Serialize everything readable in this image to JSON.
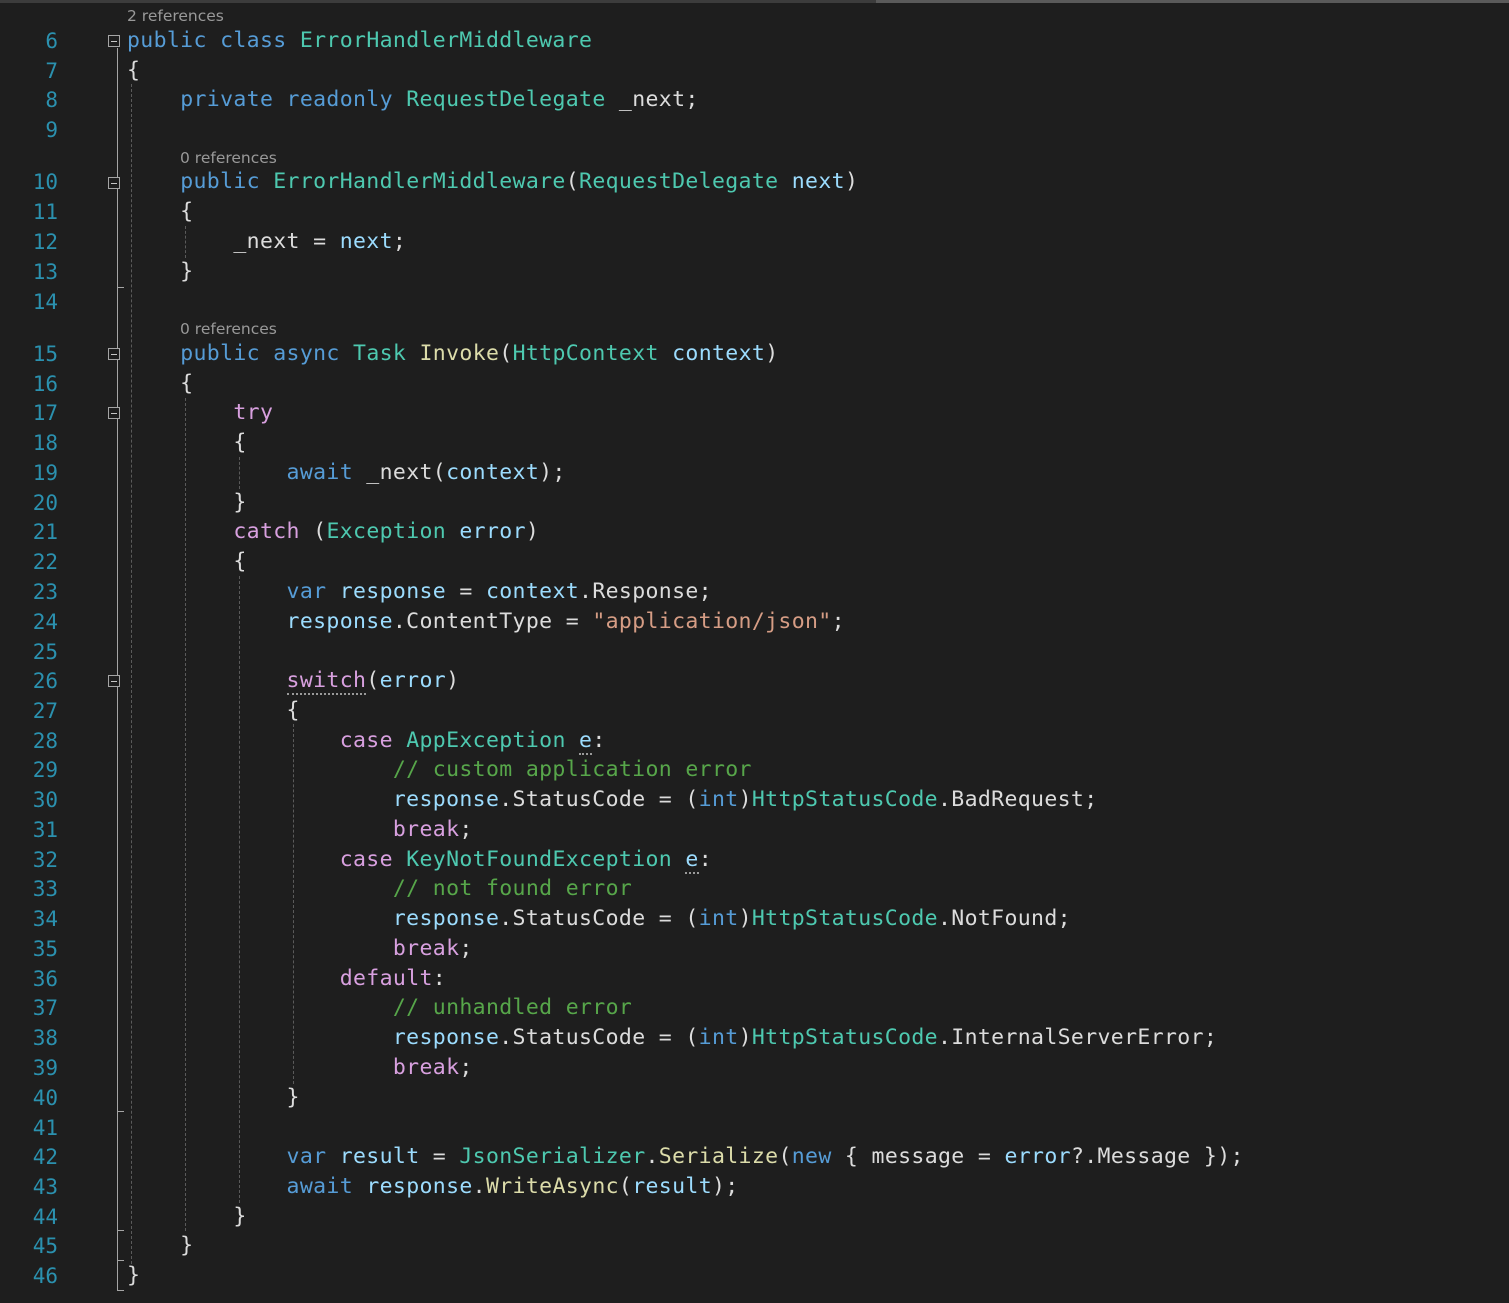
{
  "editor": {
    "language": "C#",
    "theme_colors": {
      "background": "#1e1e1e",
      "line_number": "#2b91af",
      "keyword": "#569cd6",
      "control_keyword": "#d8a0df",
      "type": "#4ec9b0",
      "method": "#dcdcaa",
      "variable": "#9cdcfe",
      "string": "#d69d85",
      "comment": "#57a64a",
      "plain": "#dcdcdc",
      "codelens": "#999999"
    },
    "codelens": {
      "class_refs": "2 references",
      "ctor_refs": "0 references",
      "invoke_refs": "0 references"
    },
    "lines": [
      {
        "num": "6",
        "tokens": [
          [
            "kw",
            "public"
          ],
          [
            "plain",
            " "
          ],
          [
            "kw",
            "class"
          ],
          [
            "plain",
            " "
          ],
          [
            "type",
            "ErrorHandlerMiddleware"
          ]
        ]
      },
      {
        "num": "7",
        "tokens": [
          [
            "plain",
            "{"
          ]
        ]
      },
      {
        "num": "8",
        "tokens": [
          [
            "plain",
            "    "
          ],
          [
            "kw",
            "private"
          ],
          [
            "plain",
            " "
          ],
          [
            "kw",
            "readonly"
          ],
          [
            "plain",
            " "
          ],
          [
            "type",
            "RequestDelegate"
          ],
          [
            "plain",
            " _next;"
          ]
        ]
      },
      {
        "num": "9",
        "tokens": []
      },
      {
        "num": "10",
        "tokens": [
          [
            "plain",
            "    "
          ],
          [
            "kw",
            "public"
          ],
          [
            "plain",
            " "
          ],
          [
            "type",
            "ErrorHandlerMiddleware"
          ],
          [
            "plain",
            "("
          ],
          [
            "type",
            "RequestDelegate"
          ],
          [
            "plain",
            " "
          ],
          [
            "var",
            "next"
          ],
          [
            "plain",
            ")"
          ]
        ]
      },
      {
        "num": "11",
        "tokens": [
          [
            "plain",
            "    {"
          ]
        ]
      },
      {
        "num": "12",
        "tokens": [
          [
            "plain",
            "        _next = "
          ],
          [
            "var",
            "next"
          ],
          [
            "plain",
            ";"
          ]
        ]
      },
      {
        "num": "13",
        "tokens": [
          [
            "plain",
            "    }"
          ]
        ]
      },
      {
        "num": "14",
        "tokens": []
      },
      {
        "num": "15",
        "tokens": [
          [
            "plain",
            "    "
          ],
          [
            "kw",
            "public"
          ],
          [
            "plain",
            " "
          ],
          [
            "kw",
            "async"
          ],
          [
            "plain",
            " "
          ],
          [
            "type",
            "Task"
          ],
          [
            "plain",
            " "
          ],
          [
            "method",
            "Invoke"
          ],
          [
            "plain",
            "("
          ],
          [
            "type",
            "HttpContext"
          ],
          [
            "plain",
            " "
          ],
          [
            "var",
            "context"
          ],
          [
            "plain",
            ")"
          ]
        ]
      },
      {
        "num": "16",
        "tokens": [
          [
            "plain",
            "    {"
          ]
        ]
      },
      {
        "num": "17",
        "tokens": [
          [
            "plain",
            "        "
          ],
          [
            "ctl",
            "try"
          ]
        ]
      },
      {
        "num": "18",
        "tokens": [
          [
            "plain",
            "        {"
          ]
        ]
      },
      {
        "num": "19",
        "tokens": [
          [
            "plain",
            "            "
          ],
          [
            "kw",
            "await"
          ],
          [
            "plain",
            " _next("
          ],
          [
            "var",
            "context"
          ],
          [
            "plain",
            ");"
          ]
        ]
      },
      {
        "num": "20",
        "tokens": [
          [
            "plain",
            "        }"
          ]
        ]
      },
      {
        "num": "21",
        "tokens": [
          [
            "plain",
            "        "
          ],
          [
            "ctl",
            "catch"
          ],
          [
            "plain",
            " ("
          ],
          [
            "type",
            "Exception"
          ],
          [
            "plain",
            " "
          ],
          [
            "var",
            "error"
          ],
          [
            "plain",
            ")"
          ]
        ]
      },
      {
        "num": "22",
        "tokens": [
          [
            "plain",
            "        {"
          ]
        ]
      },
      {
        "num": "23",
        "tokens": [
          [
            "plain",
            "            "
          ],
          [
            "kw",
            "var"
          ],
          [
            "plain",
            " "
          ],
          [
            "var",
            "response"
          ],
          [
            "plain",
            " = "
          ],
          [
            "var",
            "context"
          ],
          [
            "plain",
            ".Response;"
          ]
        ]
      },
      {
        "num": "24",
        "tokens": [
          [
            "plain",
            "            "
          ],
          [
            "var",
            "response"
          ],
          [
            "plain",
            ".ContentType = "
          ],
          [
            "str",
            "\"application/json\""
          ],
          [
            "plain",
            ";"
          ]
        ]
      },
      {
        "num": "25",
        "tokens": []
      },
      {
        "num": "26",
        "tokens": [
          [
            "plain",
            "            "
          ],
          [
            "ctl",
            "switch"
          ],
          [
            "plain",
            "("
          ],
          [
            "var",
            "error"
          ],
          [
            "plain",
            ")"
          ]
        ]
      },
      {
        "num": "27",
        "tokens": [
          [
            "plain",
            "            {"
          ]
        ]
      },
      {
        "num": "28",
        "tokens": [
          [
            "plain",
            "                "
          ],
          [
            "ctl",
            "case"
          ],
          [
            "plain",
            " "
          ],
          [
            "type",
            "AppException"
          ],
          [
            "plain",
            " "
          ],
          [
            "var",
            "e"
          ],
          [
            "plain",
            ":"
          ]
        ]
      },
      {
        "num": "29",
        "tokens": [
          [
            "plain",
            "                    "
          ],
          [
            "cmt",
            "// custom application error"
          ]
        ]
      },
      {
        "num": "30",
        "tokens": [
          [
            "plain",
            "                    "
          ],
          [
            "var",
            "response"
          ],
          [
            "plain",
            ".StatusCode = ("
          ],
          [
            "kw",
            "int"
          ],
          [
            "plain",
            ")"
          ],
          [
            "type",
            "HttpStatusCode"
          ],
          [
            "plain",
            ".BadRequest;"
          ]
        ]
      },
      {
        "num": "31",
        "tokens": [
          [
            "plain",
            "                    "
          ],
          [
            "ctl",
            "break"
          ],
          [
            "plain",
            ";"
          ]
        ]
      },
      {
        "num": "32",
        "tokens": [
          [
            "plain",
            "                "
          ],
          [
            "ctl",
            "case"
          ],
          [
            "plain",
            " "
          ],
          [
            "type",
            "KeyNotFoundException"
          ],
          [
            "plain",
            " "
          ],
          [
            "var",
            "e"
          ],
          [
            "plain",
            ":"
          ]
        ]
      },
      {
        "num": "33",
        "tokens": [
          [
            "plain",
            "                    "
          ],
          [
            "cmt",
            "// not found error"
          ]
        ]
      },
      {
        "num": "34",
        "tokens": [
          [
            "plain",
            "                    "
          ],
          [
            "var",
            "response"
          ],
          [
            "plain",
            ".StatusCode = ("
          ],
          [
            "kw",
            "int"
          ],
          [
            "plain",
            ")"
          ],
          [
            "type",
            "HttpStatusCode"
          ],
          [
            "plain",
            ".NotFound;"
          ]
        ]
      },
      {
        "num": "35",
        "tokens": [
          [
            "plain",
            "                    "
          ],
          [
            "ctl",
            "break"
          ],
          [
            "plain",
            ";"
          ]
        ]
      },
      {
        "num": "36",
        "tokens": [
          [
            "plain",
            "                "
          ],
          [
            "ctl",
            "default"
          ],
          [
            "plain",
            ":"
          ]
        ]
      },
      {
        "num": "37",
        "tokens": [
          [
            "plain",
            "                    "
          ],
          [
            "cmt",
            "// unhandled error"
          ]
        ]
      },
      {
        "num": "38",
        "tokens": [
          [
            "plain",
            "                    "
          ],
          [
            "var",
            "response"
          ],
          [
            "plain",
            ".StatusCode = ("
          ],
          [
            "kw",
            "int"
          ],
          [
            "plain",
            ")"
          ],
          [
            "type",
            "HttpStatusCode"
          ],
          [
            "plain",
            ".InternalServerError;"
          ]
        ]
      },
      {
        "num": "39",
        "tokens": [
          [
            "plain",
            "                    "
          ],
          [
            "ctl",
            "break"
          ],
          [
            "plain",
            ";"
          ]
        ]
      },
      {
        "num": "40",
        "tokens": [
          [
            "plain",
            "            }"
          ]
        ]
      },
      {
        "num": "41",
        "tokens": []
      },
      {
        "num": "42",
        "tokens": [
          [
            "plain",
            "            "
          ],
          [
            "kw",
            "var"
          ],
          [
            "plain",
            " "
          ],
          [
            "var",
            "result"
          ],
          [
            "plain",
            " = "
          ],
          [
            "type",
            "JsonSerializer"
          ],
          [
            "plain",
            "."
          ],
          [
            "method",
            "Serialize"
          ],
          [
            "plain",
            "("
          ],
          [
            "kw",
            "new"
          ],
          [
            "plain",
            " { message = "
          ],
          [
            "var",
            "error"
          ],
          [
            "plain",
            "?.Message });"
          ]
        ]
      },
      {
        "num": "43",
        "tokens": [
          [
            "plain",
            "            "
          ],
          [
            "kw",
            "await"
          ],
          [
            "plain",
            " "
          ],
          [
            "var",
            "response"
          ],
          [
            "plain",
            "."
          ],
          [
            "method",
            "WriteAsync"
          ],
          [
            "plain",
            "("
          ],
          [
            "var",
            "result"
          ],
          [
            "plain",
            ");"
          ]
        ]
      },
      {
        "num": "44",
        "tokens": [
          [
            "plain",
            "        }"
          ]
        ]
      },
      {
        "num": "45",
        "tokens": [
          [
            "plain",
            "    }"
          ]
        ]
      },
      {
        "num": "46",
        "tokens": [
          [
            "plain",
            "}"
          ]
        ]
      }
    ]
  }
}
